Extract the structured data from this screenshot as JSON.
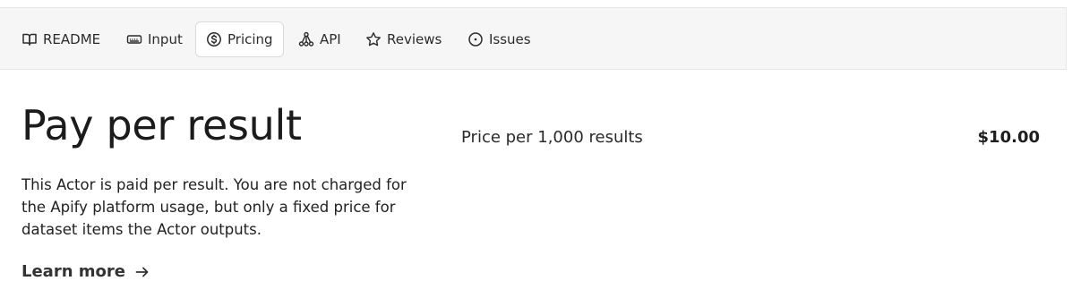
{
  "tabs": [
    {
      "label": "README",
      "icon": "book-open-icon"
    },
    {
      "label": "Input",
      "icon": "keyboard-icon"
    },
    {
      "label": "Pricing",
      "icon": "dollar-circle-icon",
      "active": true
    },
    {
      "label": "API",
      "icon": "api-nodes-icon"
    },
    {
      "label": "Reviews",
      "icon": "star-icon"
    },
    {
      "label": "Issues",
      "icon": "issue-circle-icon"
    }
  ],
  "pricing": {
    "title": "Pay per result",
    "description": "This Actor is paid per result. You are not charged for the Apify platform usage, but only a fixed price for dataset items the Actor outputs.",
    "learn_more": "Learn more",
    "price_label": "Price per 1,000 results",
    "price_value": "$10.00"
  }
}
